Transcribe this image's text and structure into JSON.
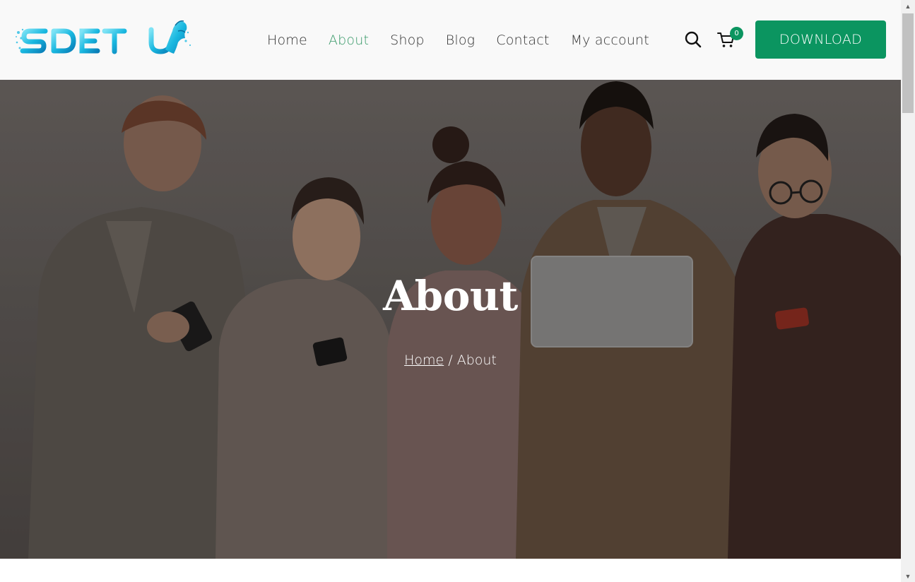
{
  "logo": {
    "text": "SDET-U",
    "alt": "SDET-U logo"
  },
  "nav": {
    "items": [
      {
        "label": "Home",
        "active": false
      },
      {
        "label": "About",
        "active": true
      },
      {
        "label": "Shop",
        "active": false
      },
      {
        "label": "Blog",
        "active": false
      },
      {
        "label": "Contact",
        "active": false
      },
      {
        "label": "My account",
        "active": false
      }
    ]
  },
  "header": {
    "search_icon": "search-icon",
    "cart_icon": "cart-icon",
    "cart_count": "0",
    "download_label": "DOWNLOAD"
  },
  "hero": {
    "title": "About",
    "breadcrumb": {
      "home": "Home",
      "separator": " / ",
      "current": "About"
    }
  },
  "colors": {
    "accent": "#0b9560",
    "active_nav": "#3a9a6a",
    "header_bg": "#f9f9f9",
    "logo_cyan": "#2fc6e8"
  }
}
